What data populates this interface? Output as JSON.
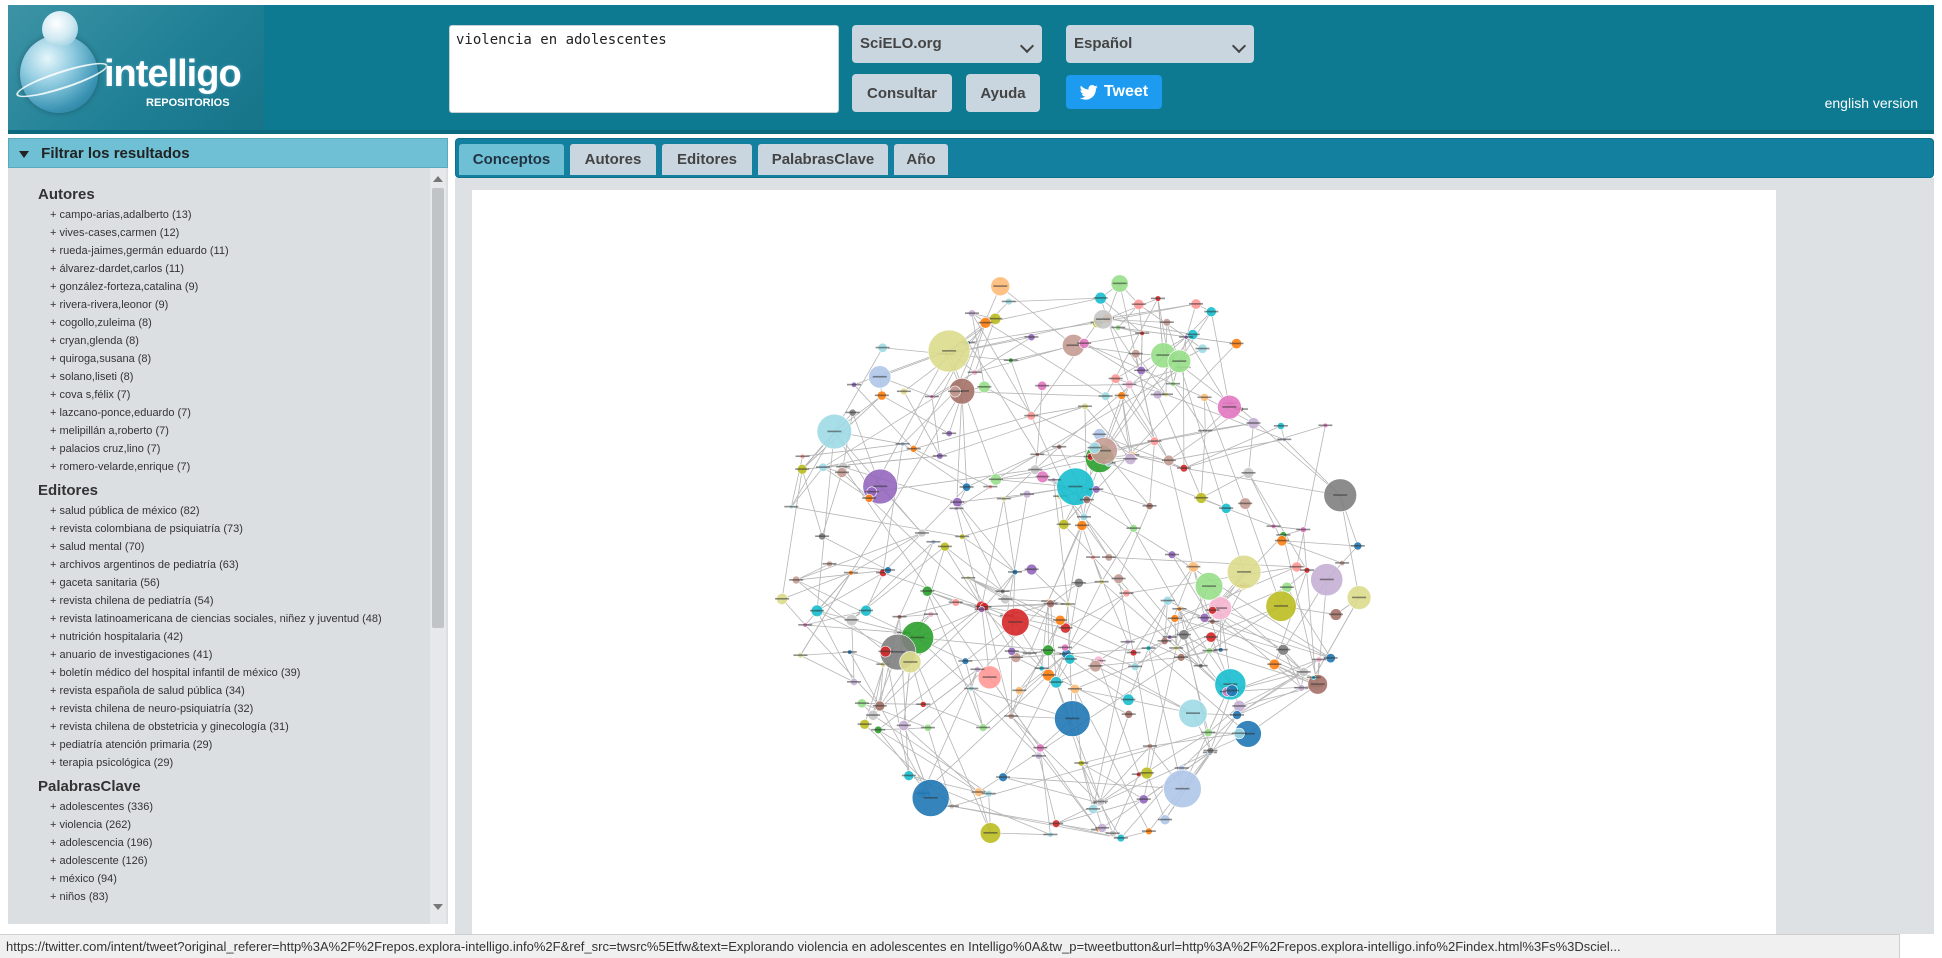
{
  "header": {
    "logo_text": "intelligo",
    "logo_sub": "REPOSITORIOS",
    "search_value": "violencia en adolescentes",
    "source_select": "SciELO.org",
    "language_select": "Español",
    "consultar_label": "Consultar",
    "ayuda_label": "Ayuda",
    "tweet_label": "Tweet",
    "english_link": "english version"
  },
  "sidebar": {
    "title": "Filtrar los resultados",
    "autores_title": "Autores",
    "autores": [
      "+ campo-arias,adalberto (13)",
      "+ vives-cases,carmen (12)",
      "+ rueda-jaimes,germán eduardo (11)",
      "+ álvarez-dardet,carlos (11)",
      "+ gonzález-forteza,catalina (9)",
      "+ rivera-rivera,leonor (9)",
      "+ cogollo,zuleima (8)",
      "+ cryan,glenda (8)",
      "+ quiroga,susana (8)",
      "+ solano,liseti (8)",
      "+ cova s,félix (7)",
      "+ lazcano-ponce,eduardo (7)",
      "+ melipillán a,roberto (7)",
      "+ palacios cruz,lino (7)",
      "+ romero-velarde,enrique (7)"
    ],
    "editores_title": "Editores",
    "editores": [
      "+ salud pública de méxico (82)",
      "+ revista colombiana de psiquiatría (73)",
      "+ salud mental (70)",
      "+ archivos argentinos de pediatría (63)",
      "+ gaceta sanitaria (56)",
      "+ revista chilena de pediatría (54)",
      "+ revista latinoamericana de ciencias sociales, niñez y juventud (48)",
      "+ nutrición hospitalaria (42)",
      "+ anuario de investigaciones (41)",
      "+ boletín médico del hospital infantil de méxico (39)",
      "+ revista española de salud pública (34)",
      "+ revista chilena de neuro-psiquiatría (32)",
      "+ revista chilena de obstetricia y ginecología (31)",
      "+ pediatría atención primaria (29)",
      "+ terapia psicológica (29)"
    ],
    "palabras_title": "PalabrasClave",
    "palabras": [
      "+ adolescentes (336)",
      "+ violencia (262)",
      "+ adolescencia (196)",
      "+ adolescente (126)",
      "+ méxico (94)",
      "+ niños (83)"
    ]
  },
  "tabs": [
    "Conceptos",
    "Autores",
    "Editores",
    "PalabrasClave",
    "Año"
  ],
  "active_tab": "Conceptos",
  "status_url": "https://twitter.com/intent/tweet?original_referer=http%3A%2F%2Frepos.explora-intelligo.info%2F&ref_src=twsrc%5Etfw&text=Explorando violencia en adolescentes en Intelligo%0A&tw_p=tweetbutton&url=http%3A%2F%2Frepos.explora-intelligo.info%2Findex.html%3Fs%3Dsciel..."
}
